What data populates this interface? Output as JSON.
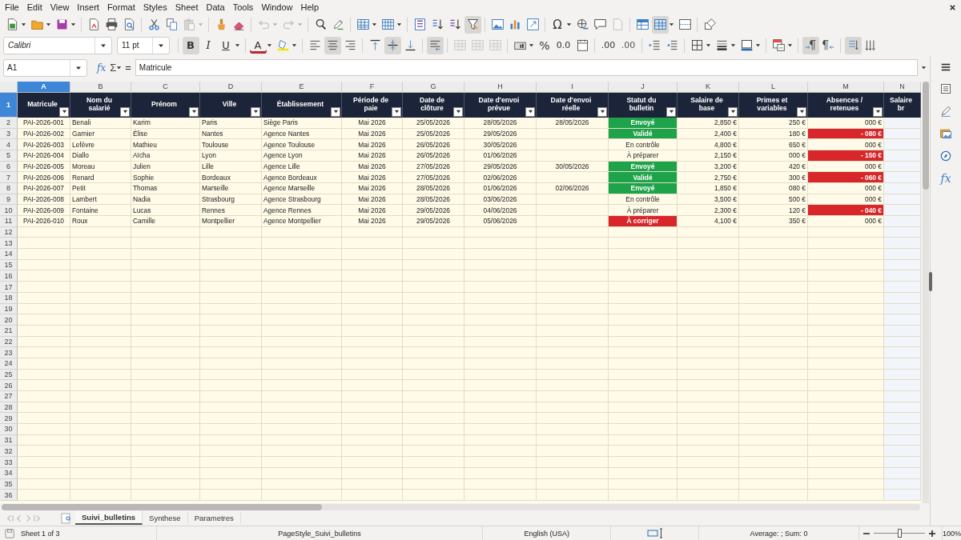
{
  "menu": [
    "File",
    "Edit",
    "View",
    "Insert",
    "Format",
    "Styles",
    "Sheet",
    "Data",
    "Tools",
    "Window",
    "Help"
  ],
  "toolbar_standard": [
    {
      "kind": "new",
      "pressed": false,
      "disabled": false,
      "dropdown": true
    },
    {
      "kind": "open",
      "pressed": false,
      "disabled": false,
      "dropdown": true
    },
    {
      "kind": "save",
      "pressed": false,
      "disabled": false,
      "dropdown": true
    },
    {
      "kind": "separator"
    },
    {
      "kind": "pdf",
      "pressed": false,
      "disabled": false,
      "dropdown": false
    },
    {
      "kind": "print",
      "pressed": false,
      "disabled": false,
      "dropdown": false
    },
    {
      "kind": "preview",
      "pressed": false,
      "disabled": false,
      "dropdown": false
    },
    {
      "kind": "separator"
    },
    {
      "kind": "cut",
      "pressed": false,
      "disabled": false,
      "dropdown": false
    },
    {
      "kind": "copy",
      "pressed": false,
      "disabled": false,
      "dropdown": false
    },
    {
      "kind": "paste",
      "pressed": false,
      "disabled": true,
      "dropdown": true
    },
    {
      "kind": "separator"
    },
    {
      "kind": "brush",
      "pressed": false,
      "disabled": false,
      "dropdown": false
    },
    {
      "kind": "eraser",
      "pressed": false,
      "disabled": false,
      "dropdown": false
    },
    {
      "kind": "separator"
    },
    {
      "kind": "undo",
      "pressed": false,
      "disabled": true,
      "dropdown": true
    },
    {
      "kind": "redo",
      "pressed": false,
      "disabled": true,
      "dropdown": true
    },
    {
      "kind": "separator"
    },
    {
      "kind": "find",
      "pressed": false,
      "disabled": false,
      "dropdown": false
    },
    {
      "kind": "spell",
      "pressed": false,
      "disabled": false,
      "dropdown": false
    },
    {
      "kind": "separator"
    },
    {
      "kind": "rows",
      "pressed": false,
      "disabled": false,
      "dropdown": true
    },
    {
      "kind": "cols",
      "pressed": false,
      "disabled": false,
      "dropdown": true
    },
    {
      "kind": "separator"
    },
    {
      "kind": "sort",
      "pressed": false,
      "disabled": false,
      "dropdown": false
    },
    {
      "kind": "sortasc",
      "pressed": false,
      "disabled": false,
      "dropdown": false
    },
    {
      "kind": "sortdesc",
      "pressed": false,
      "disabled": false,
      "dropdown": false
    },
    {
      "kind": "filter",
      "pressed": true,
      "disabled": false,
      "dropdown": false
    },
    {
      "kind": "separator"
    },
    {
      "kind": "image",
      "pressed": false,
      "disabled": false,
      "dropdown": false
    },
    {
      "kind": "chart",
      "pressed": false,
      "disabled": false,
      "dropdown": false
    },
    {
      "kind": "pivot",
      "pressed": false,
      "disabled": false,
      "dropdown": false
    },
    {
      "kind": "separator"
    },
    {
      "kind": "special",
      "label": "Ω",
      "pressed": false,
      "disabled": false,
      "dropdown": true
    },
    {
      "kind": "link",
      "pressed": false,
      "disabled": false,
      "dropdown": false
    },
    {
      "kind": "comment",
      "pressed": false,
      "disabled": false,
      "dropdown": false
    },
    {
      "kind": "header",
      "pressed": false,
      "disabled": true,
      "dropdown": false
    },
    {
      "kind": "separator"
    },
    {
      "kind": "freeze",
      "pressed": false,
      "disabled": false,
      "dropdown": false
    },
    {
      "kind": "split",
      "pressed": true,
      "disabled": false,
      "dropdown": true
    },
    {
      "kind": "pagebreak",
      "pressed": false,
      "disabled": false,
      "dropdown": false
    },
    {
      "kind": "separator"
    },
    {
      "kind": "shapes",
      "pressed": false,
      "disabled": false,
      "dropdown": false
    }
  ],
  "toolbar_format": [
    {
      "kind": "font-name",
      "value": "Calibri"
    },
    {
      "kind": "font-size",
      "value": "11 pt"
    },
    {
      "kind": "separator"
    },
    {
      "kind": "bold",
      "label": "B",
      "pressed": true,
      "disabled": false,
      "dropdown": false
    },
    {
      "kind": "italic",
      "label": "I",
      "pressed": false,
      "disabled": false,
      "dropdown": false
    },
    {
      "kind": "underline",
      "label": "U",
      "pressed": false,
      "disabled": false,
      "dropdown": true
    },
    {
      "kind": "separator"
    },
    {
      "kind": "fontcolor",
      "label": "A",
      "pressed": false,
      "disabled": false,
      "dropdown": true
    },
    {
      "kind": "highlight",
      "pressed": false,
      "disabled": false,
      "dropdown": true
    },
    {
      "kind": "separator"
    },
    {
      "kind": "alignleft",
      "pressed": false,
      "disabled": false,
      "dropdown": false
    },
    {
      "kind": "aligncenter",
      "pressed": true,
      "disabled": false,
      "dropdown": false
    },
    {
      "kind": "alignright",
      "pressed": false,
      "disabled": false,
      "dropdown": false
    },
    {
      "kind": "separator"
    },
    {
      "kind": "aligntop",
      "pressed": false,
      "disabled": false,
      "dropdown": false
    },
    {
      "kind": "alignmiddle",
      "pressed": true,
      "disabled": false,
      "dropdown": false
    },
    {
      "kind": "alignbottom",
      "pressed": false,
      "disabled": false,
      "dropdown": false
    },
    {
      "kind": "separator"
    },
    {
      "kind": "wrap",
      "pressed": true,
      "disabled": false,
      "dropdown": false
    },
    {
      "kind": "separator"
    },
    {
      "kind": "merge",
      "pressed": false,
      "disabled": true,
      "dropdown": false
    },
    {
      "kind": "merge",
      "pressed": false,
      "disabled": true,
      "dropdown": false
    },
    {
      "kind": "merge",
      "pressed": false,
      "disabled": true,
      "dropdown": false
    },
    {
      "kind": "separator"
    },
    {
      "kind": "numformat",
      "pressed": false,
      "disabled": false,
      "dropdown": true
    },
    {
      "kind": "percent",
      "label": "%",
      "pressed": false,
      "disabled": false,
      "dropdown": false
    },
    {
      "kind": "decimal",
      "label": "0.0",
      "pressed": false,
      "disabled": false,
      "dropdown": false
    },
    {
      "kind": "date",
      "pressed": false,
      "disabled": false,
      "dropdown": false
    },
    {
      "kind": "separator"
    },
    {
      "kind": "adddecimal",
      "label": ".00",
      "pressed": false,
      "disabled": false,
      "dropdown": false
    },
    {
      "kind": "deldecimal",
      "label": ".00",
      "pressed": false,
      "disabled": false,
      "dropdown": false
    },
    {
      "kind": "separator"
    },
    {
      "kind": "indent",
      "pressed": false,
      "disabled": false,
      "dropdown": false
    },
    {
      "kind": "outdent",
      "pressed": false,
      "disabled": false,
      "dropdown": false
    },
    {
      "kind": "separator"
    },
    {
      "kind": "borders",
      "pressed": false,
      "disabled": false,
      "dropdown": true
    },
    {
      "kind": "borderstyle",
      "pressed": false,
      "disabled": false,
      "dropdown": true
    },
    {
      "kind": "bordercolor",
      "pressed": false,
      "disabled": false,
      "dropdown": true
    },
    {
      "kind": "separator"
    },
    {
      "kind": "conditional",
      "pressed": false,
      "disabled": false,
      "dropdown": true
    },
    {
      "kind": "separator"
    },
    {
      "kind": "ltr",
      "pressed": true,
      "disabled": false,
      "dropdown": false
    },
    {
      "kind": "rtl",
      "pressed": false,
      "disabled": false,
      "dropdown": false
    },
    {
      "kind": "separator"
    },
    {
      "kind": "vertical",
      "pressed": true,
      "disabled": false,
      "dropdown": false
    },
    {
      "kind": "stacked",
      "pressed": false,
      "disabled": false,
      "dropdown": false
    }
  ],
  "formula_bar": {
    "cell_reference": "A1",
    "function_wizard": "fx",
    "sum": "Σ",
    "equals": "=",
    "content": "Matricule"
  },
  "columns": [
    {
      "letter": "A",
      "header": "Matricule",
      "selected": true
    },
    {
      "letter": "B",
      "header": "Nom du salarié",
      "selected": false
    },
    {
      "letter": "C",
      "header": "Prénom",
      "selected": false
    },
    {
      "letter": "D",
      "header": "Ville",
      "selected": false
    },
    {
      "letter": "E",
      "header": "Établissement",
      "selected": false
    },
    {
      "letter": "F",
      "header": "Période de paie",
      "selected": false
    },
    {
      "letter": "G",
      "header": "Date de clôture",
      "selected": false
    },
    {
      "letter": "H",
      "header": "Date d'envoi prévue",
      "selected": false
    },
    {
      "letter": "I",
      "header": "Date d'envoi réelle",
      "selected": false
    },
    {
      "letter": "J",
      "header": "Statut du bulletin",
      "selected": false
    },
    {
      "letter": "K",
      "header": "Salaire de base",
      "selected": false
    },
    {
      "letter": "L",
      "header": "Primes et variables",
      "selected": false
    },
    {
      "letter": "M",
      "header": "Absences / retenues",
      "selected": false
    },
    {
      "letter": "N",
      "header": "Salaire br",
      "selected": false
    }
  ],
  "row_headers": [
    {
      "label": "1",
      "selected": true
    },
    {
      "label": "2",
      "selected": false
    },
    {
      "label": "3",
      "selected": false
    },
    {
      "label": "4",
      "selected": false
    },
    {
      "label": "5",
      "selected": false
    },
    {
      "label": "6",
      "selected": false
    },
    {
      "label": "7",
      "selected": false
    },
    {
      "label": "8",
      "selected": false
    },
    {
      "label": "9",
      "selected": false
    },
    {
      "label": "10",
      "selected": false
    },
    {
      "label": "11",
      "selected": false
    },
    {
      "label": "12",
      "selected": false
    },
    {
      "label": "13",
      "selected": false
    },
    {
      "label": "14",
      "selected": false
    },
    {
      "label": "15",
      "selected": false
    },
    {
      "label": "16",
      "selected": false
    },
    {
      "label": "17",
      "selected": false
    },
    {
      "label": "18",
      "selected": false
    },
    {
      "label": "19",
      "selected": false
    },
    {
      "label": "20",
      "selected": false
    },
    {
      "label": "21",
      "selected": false
    },
    {
      "label": "22",
      "selected": false
    },
    {
      "label": "23",
      "selected": false
    },
    {
      "label": "24",
      "selected": false
    },
    {
      "label": "25",
      "selected": false
    },
    {
      "label": "26",
      "selected": false
    },
    {
      "label": "27",
      "selected": false
    },
    {
      "label": "28",
      "selected": false
    },
    {
      "label": "29",
      "selected": false
    },
    {
      "label": "30",
      "selected": false
    },
    {
      "label": "31",
      "selected": false
    },
    {
      "label": "32",
      "selected": false
    },
    {
      "label": "33",
      "selected": false
    },
    {
      "label": "34",
      "selected": false
    },
    {
      "label": "35",
      "selected": false
    },
    {
      "label": "36",
      "selected": false
    }
  ],
  "rows": [
    {
      "matricule": "PAI-2026-001",
      "nom": "Benali",
      "prenom": "Karim",
      "ville": "Paris",
      "etablissement": "Siège Paris",
      "periode": "Mai 2026",
      "cloture": "25/05/2026",
      "envoi_prevu": "28/05/2026",
      "envoi_reel": "28/05/2026",
      "statut": {
        "text": "Envoyé",
        "color": "#1ea34a"
      },
      "salaire_base": "2,850 €",
      "primes": "250 €",
      "absences": {
        "text": "000 €",
        "negative": false
      }
    },
    {
      "matricule": "PAI-2026-002",
      "nom": "Garnier",
      "prenom": "Élise",
      "ville": "Nantes",
      "etablissement": "Agence Nantes",
      "periode": "Mai 2026",
      "cloture": "25/05/2026",
      "envoi_prevu": "29/05/2026",
      "statut": {
        "text": "Validé",
        "color": "#1ea34a"
      },
      "salaire_base": "2,400 €",
      "primes": "180 €",
      "absences": {
        "text": "- 080 €",
        "negative": true
      }
    },
    {
      "matricule": "PAI-2026-003",
      "nom": "Lefèvre",
      "prenom": "Mathieu",
      "ville": "Toulouse",
      "etablissement": "Agence Toulouse",
      "periode": "Mai 2026",
      "cloture": "26/05/2026",
      "envoi_prevu": "30/05/2026",
      "statut": {
        "text": "En contrôle"
      },
      "salaire_base": "4,800 €",
      "primes": "650 €",
      "absences": {
        "text": "000 €",
        "negative": false
      }
    },
    {
      "matricule": "PAI-2026-004",
      "nom": "Diallo",
      "prenom": "Aïcha",
      "ville": "Lyon",
      "etablissement": "Agence Lyon",
      "periode": "Mai 2026",
      "cloture": "26/05/2026",
      "envoi_prevu": "01/06/2026",
      "statut": {
        "text": "À préparer"
      },
      "salaire_base": "2,150 €",
      "primes": "000 €",
      "absences": {
        "text": "- 150 €",
        "negative": true
      }
    },
    {
      "matricule": "PAI-2026-005",
      "nom": "Moreau",
      "prenom": "Julien",
      "ville": "Lille",
      "etablissement": "Agence Lille",
      "periode": "Mai 2026",
      "cloture": "27/05/2026",
      "envoi_prevu": "29/05/2026",
      "envoi_reel": "30/05/2026",
      "statut": {
        "text": "Envoyé",
        "color": "#1ea34a"
      },
      "salaire_base": "3,200 €",
      "primes": "420 €",
      "absences": {
        "text": "000 €",
        "negative": false
      }
    },
    {
      "matricule": "PAI-2026-006",
      "nom": "Renard",
      "prenom": "Sophie",
      "ville": "Bordeaux",
      "etablissement": "Agence Bordeaux",
      "periode": "Mai 2026",
      "cloture": "27/05/2026",
      "envoi_prevu": "02/06/2026",
      "statut": {
        "text": "Validé",
        "color": "#1ea34a"
      },
      "salaire_base": "2,750 €",
      "primes": "300 €",
      "absences": {
        "text": "- 060 €",
        "negative": true
      }
    },
    {
      "matricule": "PAI-2026-007",
      "nom": "Petit",
      "prenom": "Thomas",
      "ville": "Marseille",
      "etablissement": "Agence Marseille",
      "periode": "Mai 2026",
      "cloture": "28/05/2026",
      "envoi_prevu": "01/06/2026",
      "envoi_reel": "02/06/2026",
      "statut": {
        "text": "Envoyé",
        "color": "#1ea34a"
      },
      "salaire_base": "1,850 €",
      "primes": "080 €",
      "absences": {
        "text": "000 €",
        "negative": false
      }
    },
    {
      "matricule": "PAI-2026-008",
      "nom": "Lambert",
      "prenom": "Nadia",
      "ville": "Strasbourg",
      "etablissement": "Agence Strasbourg",
      "periode": "Mai 2026",
      "cloture": "28/05/2026",
      "envoi_prevu": "03/06/2026",
      "statut": {
        "text": "En contrôle"
      },
      "salaire_base": "3,500 €",
      "primes": "500 €",
      "absences": {
        "text": "000 €",
        "negative": false
      }
    },
    {
      "matricule": "PAI-2026-009",
      "nom": "Fontaine",
      "prenom": "Lucas",
      "ville": "Rennes",
      "etablissement": "Agence Rennes",
      "periode": "Mai 2026",
      "cloture": "29/05/2026",
      "envoi_prevu": "04/06/2026",
      "statut": {
        "text": "À préparer"
      },
      "salaire_base": "2,300 €",
      "primes": "120 €",
      "absences": {
        "text": "- 040 €",
        "negative": true
      }
    },
    {
      "matricule": "PAI-2026-010",
      "nom": "Roux",
      "prenom": "Camille",
      "ville": "Montpellier",
      "etablissement": "Agence Montpellier",
      "periode": "Mai 2026",
      "cloture": "29/05/2026",
      "envoi_prevu": "05/06/2026",
      "statut": {
        "text": "À corriger",
        "color": "#d9262b"
      },
      "salaire_base": "4,100 €",
      "primes": "350 €",
      "absences": {
        "text": "000 €",
        "negative": false
      }
    }
  ],
  "sheet_tabs": [
    {
      "label": "Suivi_bulletins",
      "selected": true
    },
    {
      "label": "Synthese",
      "selected": false
    },
    {
      "label": "Parametres",
      "selected": false
    }
  ],
  "sidebar": [
    {
      "kind": "properties"
    },
    {
      "kind": "styles"
    },
    {
      "kind": "gallery"
    },
    {
      "kind": "navigator"
    },
    {
      "kind": "functions",
      "label": "fx"
    }
  ],
  "status_bar": {
    "sheet": "Sheet 1 of 3",
    "page_style": "PageStyle_Suivi_bulletins",
    "language": "English (USA)",
    "summary": "Average: ; Sum: 0",
    "zoom_slider": {
      "level": 0.5
    },
    "zoom": "100%"
  }
}
